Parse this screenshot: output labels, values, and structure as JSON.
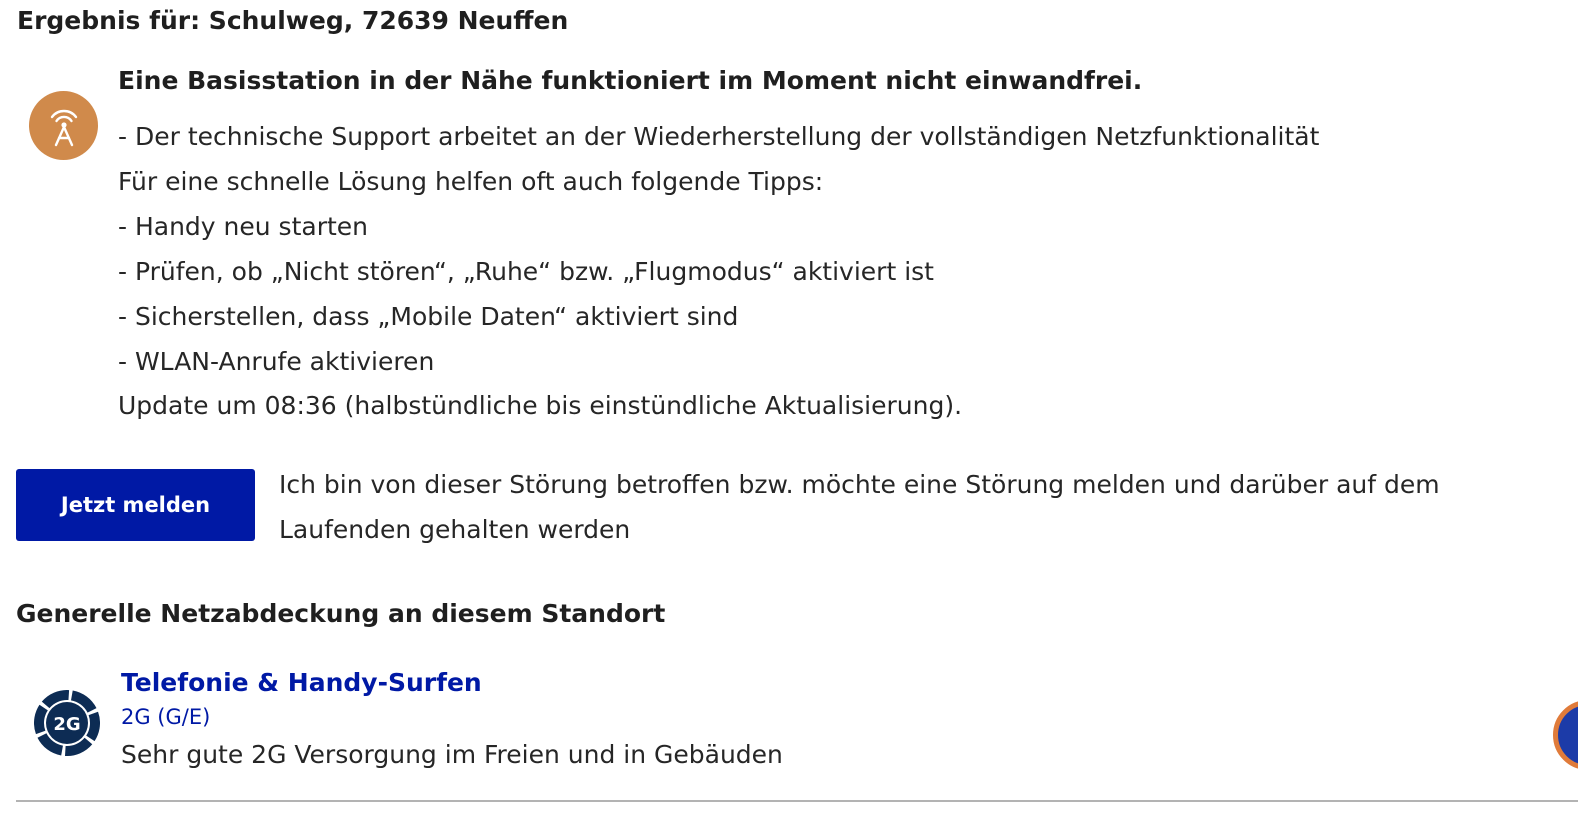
{
  "colors": {
    "brand_blue": "#0019a5",
    "warning_orange": "#d08a4b",
    "icon_navy": "#0d2c54",
    "fab_blue": "#1c3ba8",
    "fab_ring": "#e07b3a"
  },
  "result": {
    "title": "Ergebnis für: Schulweg, 72639 Neuffen"
  },
  "outage": {
    "icon": "signal-tower-icon",
    "headline": "Eine Basisstation in der Nähe funktioniert im Moment nicht einwandfrei.",
    "lines": [
      "- Der technische Support arbeitet an der Wiederherstellung der vollständigen Netzfunktionalität",
      "Für eine schnelle Lösung helfen oft auch folgende Tipps:",
      "- Handy neu starten",
      "- Prüfen, ob „Nicht stören“, „Ruhe“ bzw. „Flugmodus“ aktiviert ist",
      "- Sicherstellen, dass „Mobile Daten“ aktiviert sind",
      "- WLAN-Anrufe aktivieren"
    ],
    "update": "Update um 08:36 (halbstündliche bis einstündliche Aktualisierung)."
  },
  "report": {
    "button_label": "Jetzt melden",
    "text": "Ich bin von dieser Störung betroffen bzw. möchte eine Störung melden und darüber auf dem Laufenden gehalten werden"
  },
  "coverage": {
    "title": "Generelle Netzabdeckung an diesem Standort",
    "icon_label": "2G",
    "service": "Telefonie & Handy-Surfen",
    "technology": "2G (G/E)",
    "description": "Sehr gute 2G Versorgung im Freien und in Gebäuden"
  }
}
